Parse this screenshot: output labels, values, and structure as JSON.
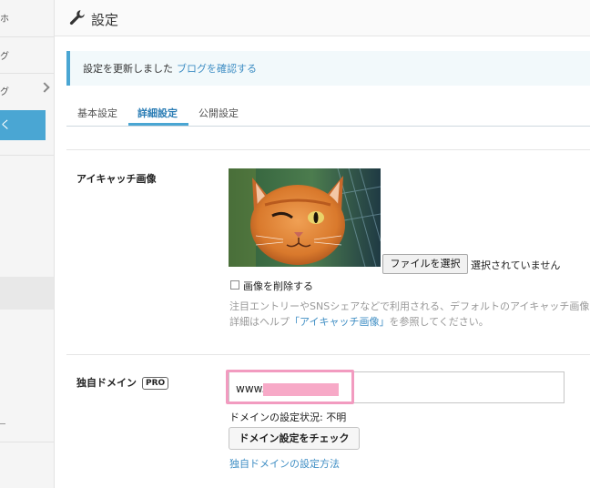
{
  "sidebar": {
    "items": [
      "ホ",
      "グ",
      "グ",
      "く"
    ],
    "active_label": "く"
  },
  "header": {
    "title": "設定",
    "icon": "wrench-icon"
  },
  "notice": {
    "message": "設定を更新しました",
    "link": "ブログを確認する"
  },
  "tabs": [
    {
      "label": "基本設定",
      "active": false
    },
    {
      "label": "詳細設定",
      "active": true
    },
    {
      "label": "公開設定",
      "active": false
    }
  ],
  "eyecatch": {
    "label": "アイキャッチ画像",
    "file_button": "ファイルを選択",
    "file_status": "選択されていません",
    "delete_label": "画像を削除する",
    "help_line1": "注目エントリーやSNSシェアなどで利用される、デフォルトのアイキャッチ画像",
    "help_line2_pre": "詳細はヘルプ",
    "help_line2_link": "「アイキャッチ画像」",
    "help_line2_post": "を参照してください。"
  },
  "domain": {
    "label": "独自ドメイン",
    "badge": "PRO",
    "value": "www.",
    "status": "ドメインの設定状況: 不明",
    "check_button": "ドメイン設定をチェック",
    "howto_link": "独自ドメインの設定方法"
  },
  "colors": {
    "accent": "#4aa6d3",
    "link": "#3f8ec4",
    "highlight": "#f29bc0"
  }
}
